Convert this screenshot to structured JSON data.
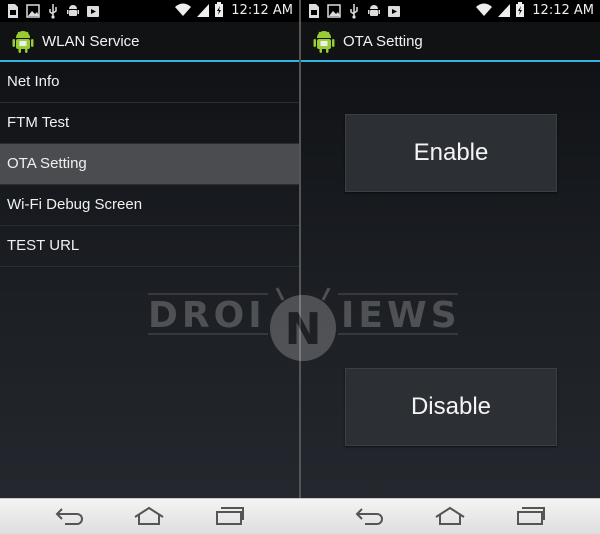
{
  "status_bar": {
    "time": "12:12 AM",
    "icons_left": [
      "sim-icon",
      "image-icon",
      "usb-icon",
      "android-debug-icon",
      "play-store-icon"
    ],
    "icons_right": [
      "wifi-icon",
      "signal-icon",
      "battery-icon"
    ]
  },
  "left_screen": {
    "title": "WLAN Service",
    "list_items": [
      {
        "label": "Net Info"
      },
      {
        "label": "FTM Test"
      },
      {
        "label": "OTA Setting",
        "selected": true
      },
      {
        "label": "Wi-Fi Debug Screen"
      },
      {
        "label": "TEST URL"
      }
    ]
  },
  "right_screen": {
    "title": "OTA Setting",
    "enable_label": "Enable",
    "disable_label": "Disable"
  },
  "watermark": {
    "left_text": "DROI",
    "letter": "N",
    "right_text": "IEWS"
  },
  "colors": {
    "accent": "#33b5e5",
    "selected": "#4a4c4f",
    "button": "#2c3035"
  },
  "nav_bar": {
    "buttons": [
      "back-icon",
      "home-icon",
      "recents-icon"
    ]
  }
}
